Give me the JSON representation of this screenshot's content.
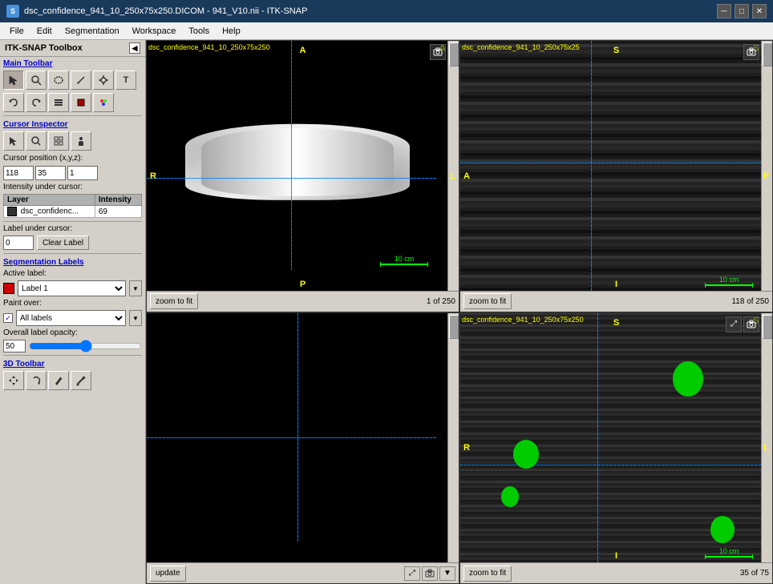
{
  "titlebar": {
    "title": "dsc_confidence_941_10_250x75x250.DICOM - 941_V10.nii - ITK-SNAP",
    "app_name": "ITK-SNAP"
  },
  "menubar": {
    "items": [
      "File",
      "Edit",
      "Segmentation",
      "Workspace",
      "Tools",
      "Help"
    ]
  },
  "toolbox": {
    "title": "ITK-SNAP Toolbox",
    "main_toolbar_label": "Main Toolbar",
    "cursor_inspector_label": "Cursor Inspector",
    "segmentation_labels_label": "Segmentation Labels",
    "toolbar_3d_label": "3D Toolbar",
    "cursor_position_label": "Cursor position (x,y,z):",
    "cursor_x": "118",
    "cursor_y": "35",
    "cursor_z": "1",
    "intensity_label": "Intensity under cursor:",
    "layer_header": "Layer",
    "intensity_header": "Intensity",
    "layer_name": "dsc_confidenc...",
    "layer_intensity": "69",
    "label_under_cursor": "Label under cursor:",
    "label_value": "0",
    "clear_label_btn": "Clear Label",
    "active_label_text": "Active label:",
    "label_name": "Label 1",
    "paint_over_text": "Paint over:",
    "all_labels_text": "All labels",
    "overall_opacity_text": "Overall label opacity:",
    "opacity_value": "50"
  },
  "viewports": {
    "top_left": {
      "filename": "dsc_confidence_941_10_250x75x250",
      "corner_label": "A",
      "top_label": "A",
      "bottom_label": "P",
      "left_label": "R",
      "right_label": "L",
      "zoom_btn": "zoom to fit",
      "slice_info": "1 of 250"
    },
    "top_right": {
      "filename": "dsc_confidence_941_10_250x75x25",
      "corner_label": "S",
      "corner_label2": "S",
      "top_label": "S",
      "bottom_label": "I",
      "left_label": "A",
      "right_label": "P",
      "zoom_btn": "zoom to fit",
      "slice_info": "118 of 250"
    },
    "bottom_left": {
      "filename": "",
      "corner_label": "",
      "zoom_btn": "update",
      "slice_info": ""
    },
    "bottom_right": {
      "filename": "dsc_confidence_941_10_250x75x250",
      "corner_label": "S",
      "top_label": "S",
      "bottom_label": "I",
      "left_label": "R",
      "right_label": "L",
      "zoom_btn": "zoom to fit",
      "slice_info": "35 of 75"
    }
  },
  "icons": {
    "cursor": "↖",
    "magnify": "🔍",
    "lasso": "⌓",
    "pencil": "✏",
    "dollar": "⊕",
    "text": "T",
    "undo": "↩",
    "redo": "↪",
    "layer": "▤",
    "segment": "■",
    "color": "🎨",
    "zoom_in": "🔍",
    "grid": "⊞",
    "person": "♟",
    "camera": "📷",
    "move": "✛",
    "rotate": "↻",
    "paint": "🖌",
    "dropper": "💉",
    "expand": "⤢",
    "contract": "⤡",
    "screenshot": "⊡",
    "down_arrow": "▼"
  }
}
